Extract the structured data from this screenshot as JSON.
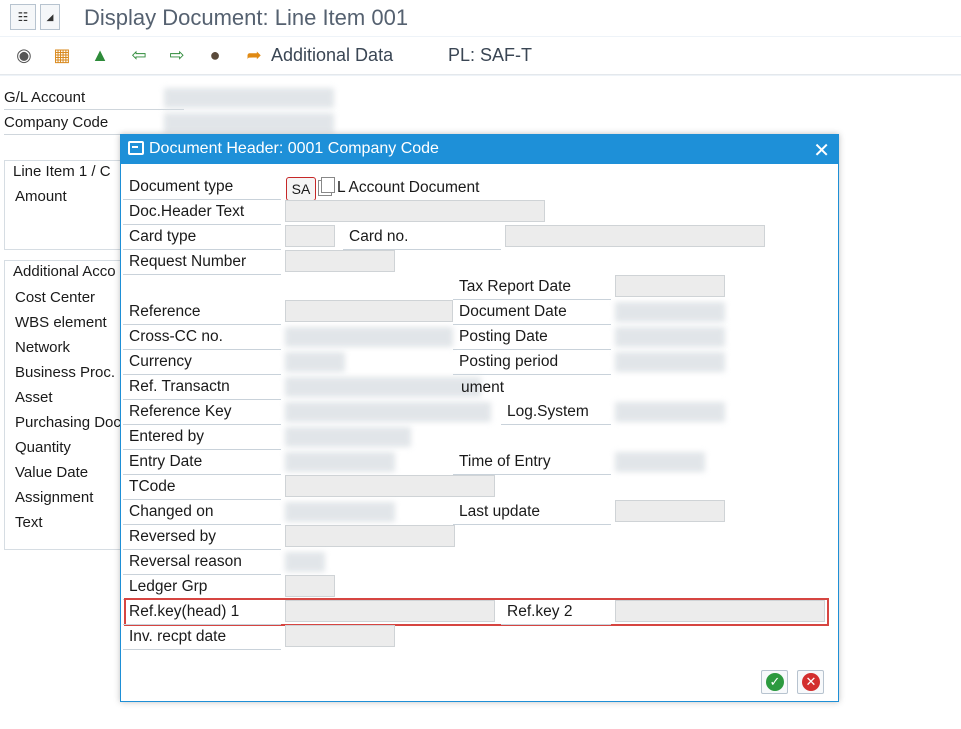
{
  "window": {
    "title": "Display Document: Line Item 001"
  },
  "toolbar": {
    "icons": [
      "glasses-icon",
      "export-icon",
      "landscape-icon",
      "arrow-left-icon",
      "arrow-right-icon",
      "hat-icon",
      "arrow-share-icon"
    ],
    "additional_data_label": "Additional Data",
    "pl_saft_label": "PL: SAF-T"
  },
  "background": {
    "gl_account_label": "G/L Account",
    "company_code_label": "Company Code",
    "line_item_title": "Line Item 1 / C",
    "amount_label": "Amount",
    "additional_title": "Additional Acco",
    "fields": [
      "Cost Center",
      "WBS element",
      "Network",
      "Business Proc.",
      "Asset",
      "Purchasing Doc",
      "Quantity",
      "Value Date",
      "Assignment",
      "Text"
    ]
  },
  "dialog": {
    "title": "Document Header: 0001 Company Code",
    "document_type_label": "Document type",
    "document_type_value": "SA",
    "document_type_desc": "L Account Document",
    "doc_header_text_label": "Doc.Header Text",
    "card_type_label": "Card type",
    "card_no_label": "Card no.",
    "request_number_label": "Request Number",
    "tax_report_date_label": "Tax Report Date",
    "reference_label": "Reference",
    "document_date_label": "Document Date",
    "cross_cc_label": "Cross-CC no.",
    "posting_date_label": "Posting Date",
    "currency_label": "Currency",
    "posting_period_label": "Posting period",
    "ref_transactn_label": "Ref. Transactn",
    "ref_transactn_desc": "ument",
    "reference_key_label": "Reference Key",
    "log_system_label": "Log.System",
    "entered_by_label": "Entered by",
    "entry_date_label": "Entry Date",
    "time_of_entry_label": "Time of Entry",
    "tcode_label": "TCode",
    "changed_on_label": "Changed on",
    "last_update_label": "Last update",
    "reversed_by_label": "Reversed by",
    "reversal_reason_label": "Reversal reason",
    "ledger_grp_label": "Ledger Grp",
    "ref_key_head1_label": "Ref.key(head) 1",
    "ref_key2_label": "Ref.key 2",
    "inv_recpt_date_label": "Inv. recpt date"
  },
  "colors": {
    "dialog_header": "#1e90d8",
    "highlight": "#d64541",
    "ok": "#2c9a3f",
    "cancel": "#d32f2f"
  }
}
